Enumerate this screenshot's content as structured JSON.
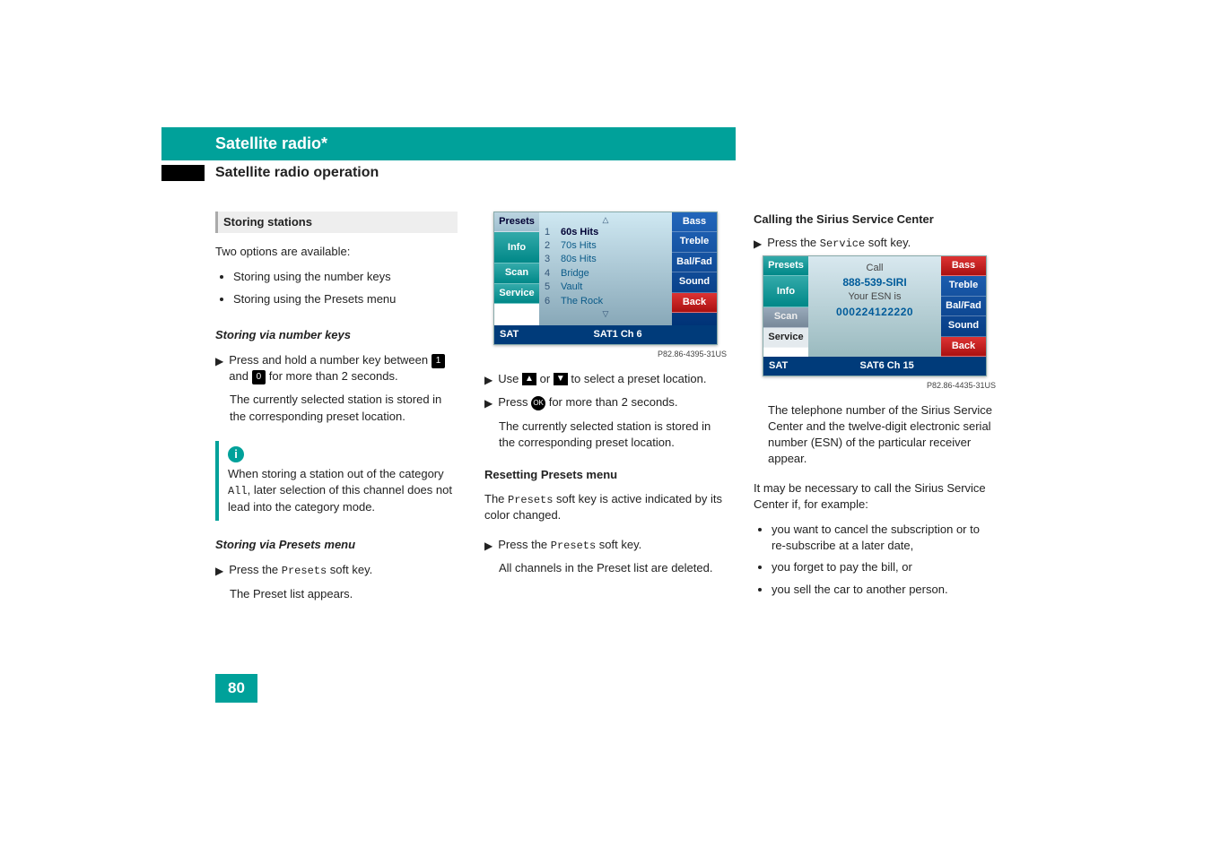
{
  "header": {
    "title": "Satellite radio*",
    "subtitle": "Satellite radio operation"
  },
  "col1": {
    "section": "Storing stations",
    "intro": "Two options are available:",
    "options": [
      "Storing using the number keys",
      "Storing using the Presets menu"
    ],
    "h_via_keys": "Storing via number keys",
    "step_press_hold_a": "Press and hold a number key between",
    "step_press_hold_b": "and",
    "step_press_hold_c": "for more than 2 seconds.",
    "key1": "1",
    "key0": "0",
    "result_stored": "The currently selected station is stored in the corresponding preset location.",
    "info_icon": "i",
    "note_a": "When storing a station out of the category ",
    "note_all": "All",
    "note_b": ", later selection of this channel does not lead into the category mode.",
    "h_via_presets": "Storing via Presets menu",
    "press_presets_a": "Press the ",
    "press_presets_key": "Presets",
    "press_presets_b": " soft key.",
    "preset_list_appears": "The Preset list appears."
  },
  "display1": {
    "left": {
      "presets": "Presets",
      "info": "Info",
      "scan": "Scan",
      "service": "Service"
    },
    "right": {
      "bass": "Bass",
      "treble": "Treble",
      "balfad": "Bal/Fad",
      "sound": "Sound",
      "back": "Back"
    },
    "rows": [
      {
        "n": "1",
        "t": "60s Hits"
      },
      {
        "n": "2",
        "t": "70s Hits"
      },
      {
        "n": "3",
        "t": "80s Hits"
      },
      {
        "n": "4",
        "t": "Bridge"
      },
      {
        "n": "5",
        "t": "Vault"
      },
      {
        "n": "6",
        "t": "The Rock"
      }
    ],
    "sub_sat": "SAT",
    "sub_center": "SAT1   Ch 6",
    "caption": "P82.86-4395-31US"
  },
  "col2": {
    "use_ab_a": "Use",
    "use_ab_b": "or",
    "use_ab_c": "to select a preset location.",
    "press_ok_a": "Press",
    "press_ok_b": "for more than 2 seconds.",
    "ok": "OK",
    "result_stored": "The currently selected station is stored in the corresponding preset location.",
    "h_reset": "Resetting Presets menu",
    "reset_intro_a": "The ",
    "reset_intro_key": "Presets",
    "reset_intro_b": " soft key is active indicated by its color changed.",
    "press_presets_a": "Press the ",
    "press_presets_key": "Presets",
    "press_presets_b": " soft key.",
    "reset_result": "All channels in the Preset list are deleted."
  },
  "col3": {
    "h_call": "Calling the Sirius Service Center",
    "press_service_a": "Press the ",
    "press_service_key": "Service",
    "press_service_b": " soft key."
  },
  "display2": {
    "left": {
      "presets": "Presets",
      "info": "Info",
      "scan": "Scan",
      "service": "Service"
    },
    "right": {
      "bass": "Bass",
      "treble": "Treble",
      "balfad": "Bal/Fad",
      "sound": "Sound",
      "back": "Back"
    },
    "center": {
      "call": "Call",
      "phone": "888-539-SIRI",
      "esn_label": "Your ESN is",
      "esn": "000224122220"
    },
    "sub_sat": "SAT",
    "sub_center": "SAT6   Ch 15",
    "caption": "P82.86-4435-31US"
  },
  "col3b": {
    "result": "The telephone number of the Sirius Service Center and the twelve-digit electronic serial number (ESN) of the particular receiver appear.",
    "maybe": "It may be necessary to call the Sirius Service Center if, for example:",
    "reasons": [
      "you want to cancel the subscription or to re-subscribe at a later date,",
      "you forget to pay the bill, or",
      "you sell the car to another person."
    ]
  },
  "page_number": "80"
}
